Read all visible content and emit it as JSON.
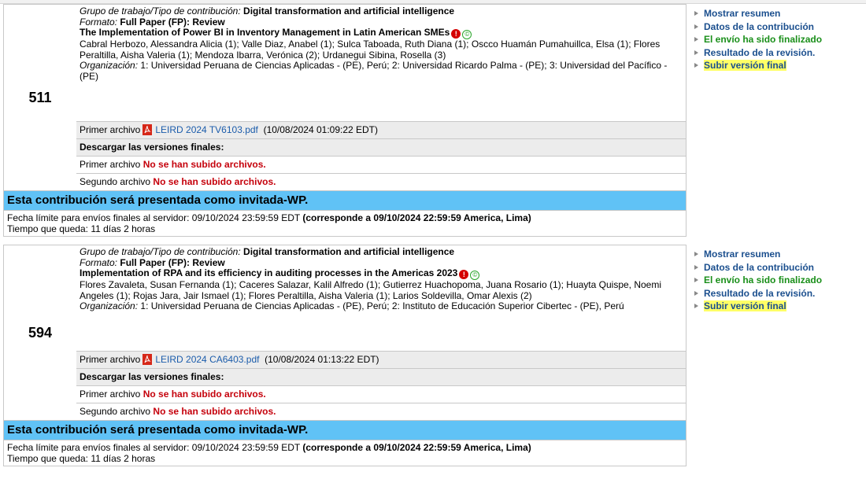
{
  "labels": {
    "group": "Grupo de trabajo/Tipo de contribución:",
    "format": "Formato:",
    "organization": "Organización:",
    "first_file": "Primer archivo",
    "second_file": "Segundo archivo",
    "download_finals": "Descargar las versiones finales:",
    "no_files": "No se han subido archivos.",
    "deadline_prefix": "Fecha límite para envíos finales al servidor:",
    "time_left_prefix": "Tiempo que queda:"
  },
  "icons": {
    "pdf": "pdf-icon",
    "warning": "exclamation-icon",
    "copyright": "copyright-icon",
    "bullet": "triangle-bullet-icon"
  },
  "colors": {
    "banner": "#60c2f6",
    "link": "#1b5cab",
    "red": "#c5000b",
    "green": "#1a8f1a",
    "highlight": "#ffff66"
  },
  "submissions": [
    {
      "number": "511",
      "group": "Digital transformation and artificial intelligence",
      "format": "Full Paper (FP): Review",
      "title": "The Implementation of Power BI in Inventory Management in Latin American SMEs",
      "authors": "Cabral Herbozo, Alessandra Alicia (1); Valle Diaz, Anabel (1); Sulca Taboada, Ruth Diana (1); Oscco Huamán Pumahuillca, Elsa (1); Flores Peraltilla, Aisha Valeria (1); Mendoza Ibarra, Verónica (2); Urdanegui Sibina, Rosella (3)",
      "organization": "1: Universidad Peruana de Ciencias Aplicadas - (PE), Perú; 2: Universidad Ricardo Palma - (PE); 3: Universidad del Pacífico - (PE)",
      "file_name": "LEIRD 2024 TV6103.pdf",
      "file_date": "(10/08/2024 01:09:22 EDT)",
      "banner": "Esta contribución será presentada como invitada-WP.",
      "deadline": "09/10/2024 23:59:59 EDT",
      "deadline_local": "(corresponde a 09/10/2024 22:59:59 America, Lima)",
      "time_left": "11 días 2 horas",
      "actions": [
        "Mostrar resumen",
        "Datos de la contribución",
        "El envío ha sido finalizado",
        "Resultado de la revisión.",
        "Subir versión final"
      ]
    },
    {
      "number": "594",
      "group": "Digital transformation and artificial intelligence",
      "format": "Full Paper (FP): Review",
      "title": "Implementation of RPA and its efficiency in auditing processes in the Americas 2023",
      "authors": "Flores Zavaleta, Susan Fernanda (1); Caceres Salazar, Kalil Alfredo (1); Gutierrez Huachopoma, Juana Rosario (1); Huayta Quispe, Noemi Angeles (1); Rojas Jara, Jair Ismael (1); Flores Peraltilla, Aisha Valeria (1); Larios Soldevilla, Omar Alexis (2)",
      "organization": "1: Universidad Peruana de Ciencias Aplicadas - (PE), Perú; 2: Instituto de Educación Superior Cibertec - (PE), Perú",
      "file_name": "LEIRD 2024 CA6403.pdf",
      "file_date": "(10/08/2024 01:13:22 EDT)",
      "banner": "Esta contribución será presentada como invitada-WP.",
      "deadline": "09/10/2024 23:59:59 EDT",
      "deadline_local": "(corresponde a 09/10/2024 22:59:59 America, Lima)",
      "time_left": "11 días 2 horas",
      "actions": [
        "Mostrar resumen",
        "Datos de la contribución",
        "El envío ha sido finalizado",
        "Resultado de la revisión.",
        "Subir versión final"
      ]
    }
  ]
}
